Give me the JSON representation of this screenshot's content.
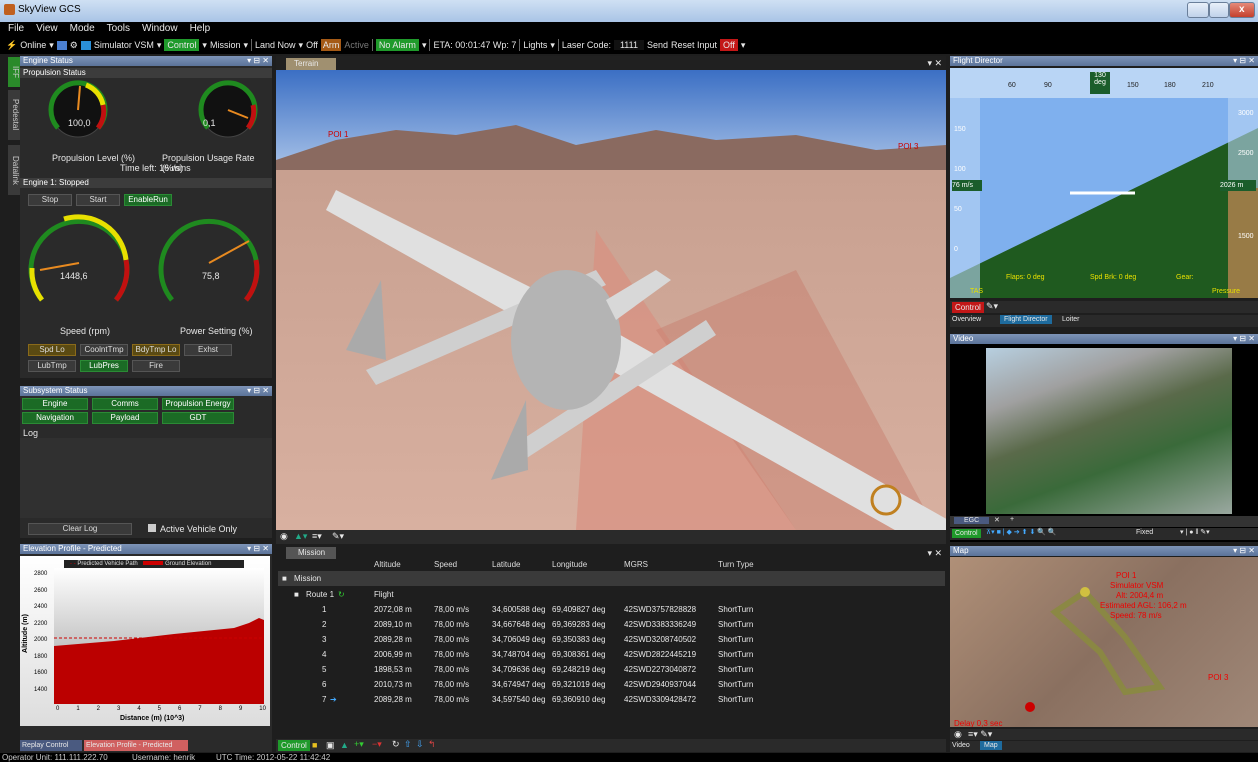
{
  "window": {
    "title": "SkyView GCS"
  },
  "menu": [
    "File",
    "View",
    "Mode",
    "Tools",
    "Window",
    "Help"
  ],
  "toolbar": {
    "online": "Online",
    "sim": "Simulator VSM",
    "control": "Control",
    "mission": "Mission",
    "land": "Land Now",
    "off1": "Off",
    "arm": "Arm",
    "active": "Active",
    "alarm": "No Alarm",
    "eta": "ETA: 00:01:47 Wp: 7",
    "lights": "Lights",
    "laser": "Laser Code:",
    "code": "1111",
    "send": "Send",
    "reset": "Reset Input",
    "off2": "Off"
  },
  "engine": {
    "title": "Engine Status",
    "prop_title": "Propulsion Status",
    "g1_val": "100,0",
    "g2_val": "0,1",
    "g1_label": "Propulsion Level (%)",
    "g2_label": "Propulsion Usage Rate (%/s)",
    "time_left": "Time left: 16 mins",
    "engine_state": "Engine 1: Stopped",
    "stop": "Stop",
    "start": "Start",
    "enable": "EnableRun",
    "g3_val": "1448,6",
    "g4_val": "75,8",
    "g3_label": "Speed (rpm)",
    "g4_label": "Power Setting (%)",
    "warn": [
      "Spd Lo",
      "CoolntTmp",
      "BdyTmp Lo",
      "Exhst",
      "LubTmp",
      "LubPres",
      "Fire"
    ]
  },
  "side_tabs": [
    "IFF",
    "Pedestal",
    "Datalink"
  ],
  "subsystem": {
    "title": "Subsystem Status",
    "items": [
      "Engine",
      "Comms",
      "Propulsion Energy",
      "Navigation",
      "Payload",
      "GDT"
    ],
    "log": "Log",
    "clear": "Clear Log",
    "active_only": "Active Vehicle Only"
  },
  "elevation": {
    "title": "Elevation Profile - Predicted",
    "legend1": "Predicted Vehicle Path",
    "legend2": "Ground Elevation",
    "ylabel": "Altitude (m)",
    "xlabel": "Distance (m) (10^3)",
    "yticks": [
      "2800",
      "2600",
      "2400",
      "2200",
      "2000",
      "1800",
      "1600",
      "1400"
    ],
    "xticks": [
      "0",
      "1",
      "2",
      "3",
      "4",
      "5",
      "6",
      "7",
      "8",
      "9",
      "10"
    ],
    "tab1": "Replay Control",
    "tab2": "Elevation Profile - Predicted"
  },
  "terrain": {
    "tab": "Terrain",
    "poi1": "POI 1",
    "poi3": "POI 3"
  },
  "mission": {
    "tab": "Mission",
    "cols": [
      "Altitude",
      "Speed",
      "Latitude",
      "Longitude",
      "MGRS",
      "Turn Type"
    ],
    "root": "Mission",
    "route": "Route 1",
    "flight": "Flight",
    "rows": [
      {
        "n": "1",
        "alt": "2072,08 m",
        "spd": "78,00 m/s",
        "lat": "34,600588 deg",
        "lon": "69,409827 deg",
        "mgrs": "42SWD3757828828",
        "turn": "ShortTurn"
      },
      {
        "n": "2",
        "alt": "2089,10 m",
        "spd": "78,00 m/s",
        "lat": "34,667648 deg",
        "lon": "69,369283 deg",
        "mgrs": "42SWD3383336249",
        "turn": "ShortTurn"
      },
      {
        "n": "3",
        "alt": "2089,28 m",
        "spd": "78,00 m/s",
        "lat": "34,706049 deg",
        "lon": "69,350383 deg",
        "mgrs": "42SWD3208740502",
        "turn": "ShortTurn"
      },
      {
        "n": "4",
        "alt": "2006,99 m",
        "spd": "78,00 m/s",
        "lat": "34,748704 deg",
        "lon": "69,308361 deg",
        "mgrs": "42SWD2822445219",
        "turn": "ShortTurn"
      },
      {
        "n": "5",
        "alt": "1898,53 m",
        "spd": "78,00 m/s",
        "lat": "34,709636 deg",
        "lon": "69,248219 deg",
        "mgrs": "42SWD2273040872",
        "turn": "ShortTurn"
      },
      {
        "n": "6",
        "alt": "2010,73 m",
        "spd": "78,00 m/s",
        "lat": "34,674947 deg",
        "lon": "69,321019 deg",
        "mgrs": "42SWD2940937044",
        "turn": "ShortTurn"
      },
      {
        "n": "7",
        "alt": "2089,28 m",
        "spd": "78,00 m/s",
        "lat": "34,597540 deg",
        "lon": "69,360910 deg",
        "mgrs": "42SWD3309428472",
        "turn": "ShortTurn"
      }
    ],
    "control": "Control"
  },
  "fd": {
    "title": "Flight Director",
    "heading": "130",
    "deg": "deg",
    "hticks": [
      "60",
      "90",
      "150",
      "180",
      "210"
    ],
    "speed": "76 m/s",
    "alt": "2026 m",
    "sticks": [
      "150",
      "100",
      "50",
      "0"
    ],
    "aticks": [
      "3000",
      "2500",
      "1500"
    ],
    "flaps": "Flaps: 0 deg",
    "spdbrk": "Spd Brk: 0 deg",
    "gear": "Gear:",
    "tas": "TAS",
    "pressure": "Pressure",
    "control": "Control",
    "tabs": [
      "Overview",
      "Flight Director",
      "Loiter"
    ]
  },
  "video": {
    "title": "Video",
    "tab": "EGC",
    "fixed": "Fixed",
    "control": "Control"
  },
  "map": {
    "title": "Map",
    "poi1": "POI 1",
    "sim": "Simulator VSM",
    "alt": "Alt: 2004,4 m",
    "agl": "Estimated AGL: 106,2 m",
    "speed": "Speed: 78 m/s",
    "poi3": "POI 3",
    "delay": "Delay 0,3 sec",
    "tabs": [
      "Video",
      "Map"
    ]
  },
  "status": {
    "operator": "Operator Unit: 111.111.222.70",
    "user": "Username: henrik",
    "utc": "UTC Time: 2012-05-22 11:42:42"
  }
}
